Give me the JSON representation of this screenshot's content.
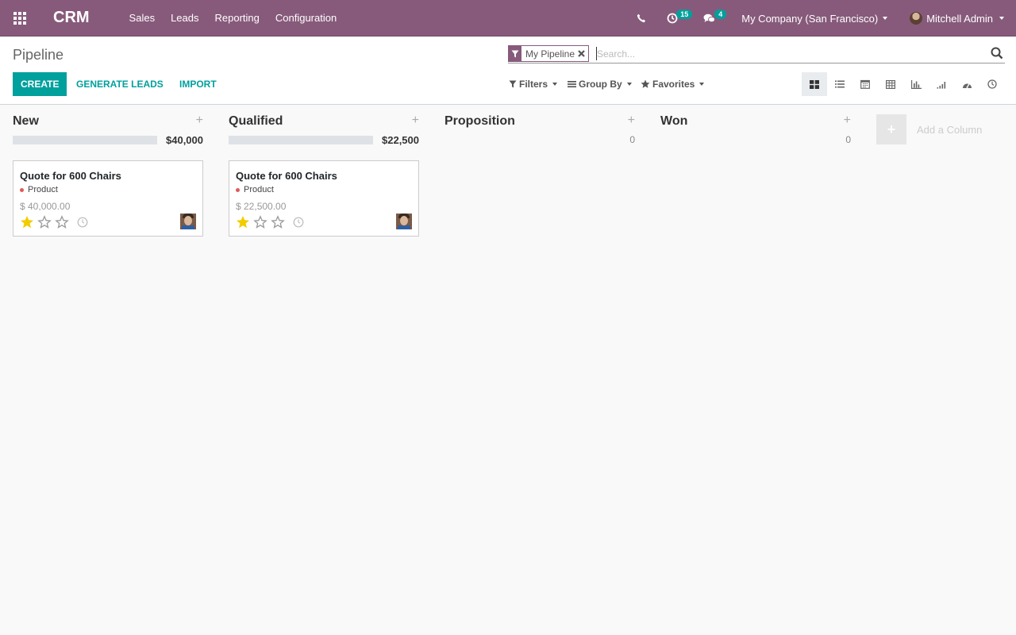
{
  "navbar": {
    "brand": "CRM",
    "menu": [
      {
        "label": "Sales"
      },
      {
        "label": "Leads"
      },
      {
        "label": "Reporting"
      },
      {
        "label": "Configuration"
      }
    ],
    "activity_count": "15",
    "messages_count": "4",
    "company": "My Company (San Francisco)",
    "user": "Mitchell Admin"
  },
  "control_panel": {
    "breadcrumb": "Pipeline",
    "create_label": "CREATE",
    "generate_leads_label": "GENERATE LEADS",
    "import_label": "IMPORT",
    "search": {
      "facet_label": "My Pipeline",
      "placeholder": "Search..."
    },
    "filters_label": "Filters",
    "group_by_label": "Group By",
    "favorites_label": "Favorites",
    "views": [
      "kanban",
      "list",
      "calendar",
      "pivot",
      "graph",
      "cohort",
      "dashboard",
      "activity"
    ]
  },
  "kanban": {
    "columns": [
      {
        "title": "New",
        "sum": "$40,000",
        "card": {
          "title": "Quote for 600 Chairs",
          "tag": "Product",
          "amount": "$ 40,000.00",
          "priority_stars": 1,
          "max_stars": 3
        }
      },
      {
        "title": "Qualified",
        "sum": "$22,500",
        "card": {
          "title": "Quote for 600 Chairs",
          "tag": "Product",
          "amount": "$ 22,500.00",
          "priority_stars": 1,
          "max_stars": 3
        }
      },
      {
        "title": "Proposition",
        "sum": "0"
      },
      {
        "title": "Won",
        "sum": "0"
      }
    ],
    "add_column_label": "Add a Column"
  },
  "colors": {
    "primary": "#875a7b",
    "accent": "#00a09d",
    "star": "#f3cc00",
    "tag": "#e15a5a"
  }
}
